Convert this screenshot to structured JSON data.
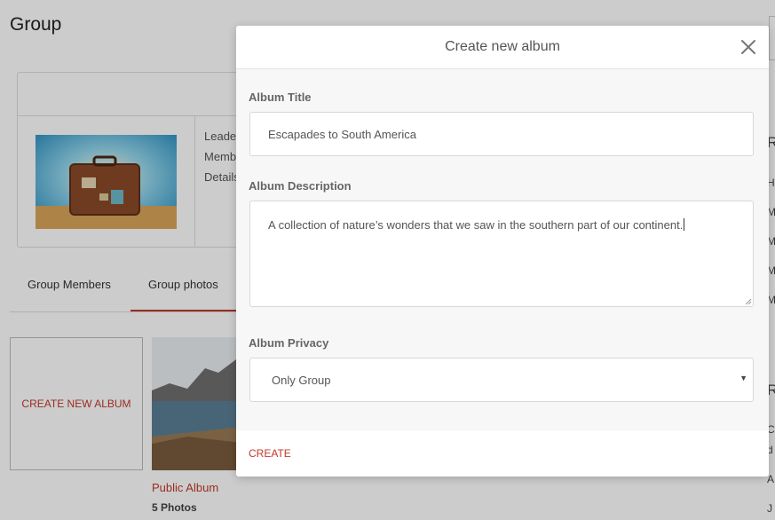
{
  "page": {
    "title": "Group",
    "info": {
      "leader_label": "Leade",
      "members_label": "Memb",
      "details_label": "Details"
    },
    "tabs": [
      {
        "label": "Group Members",
        "active": false
      },
      {
        "label": "Group photos",
        "active": true
      }
    ],
    "create_album_tile": "CREATE NEW ALBUM",
    "albums": [
      {
        "name": "Public Album",
        "count": "5 Photos"
      }
    ],
    "right_column": {
      "headings": [
        "R",
        "R"
      ],
      "lines": [
        "H",
        "M",
        "M",
        "M",
        "M",
        "C",
        "d",
        "A",
        "J"
      ]
    },
    "accent_color": "#c0392b"
  },
  "modal": {
    "title": "Create new album",
    "close_icon": "close-icon",
    "album_title": {
      "label": "Album Title",
      "value": "Escapades to South America"
    },
    "album_description": {
      "label": "Album Description",
      "value": "A collection of nature’s wonders that we saw in the southern part of our continent."
    },
    "album_privacy": {
      "label": "Album Privacy",
      "selected": "Only Group"
    },
    "create_label": "CREATE"
  }
}
